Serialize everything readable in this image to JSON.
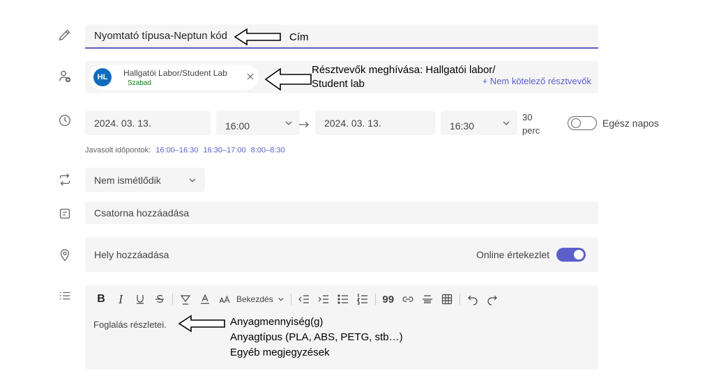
{
  "title": {
    "value": "Nyomtató típusa-Neptun kód"
  },
  "attendees": {
    "chip": {
      "initials": "HL",
      "name": "Hallgatói Labor/Student Lab",
      "status": "Szabad"
    },
    "optional_link": "+ Nem kötelező résztvevők"
  },
  "schedule": {
    "start_date": "2024. 03. 13.",
    "start_time": "16:00",
    "end_date": "2024. 03. 13.",
    "end_time": "16:30",
    "duration_value": "30",
    "duration_unit": "perc",
    "all_day_label": "Egész napos",
    "all_day_on": false
  },
  "suggestions": {
    "label": "Javasolt időpontok:",
    "slots": [
      "16:00–16:30",
      "16:30–17:00",
      "8:00–8:30"
    ]
  },
  "repeat": {
    "value": "Nem ismétlődik"
  },
  "channel": {
    "placeholder": "Csatorna hozzáadása"
  },
  "location": {
    "placeholder": "Hely hozzáadása",
    "online_label": "Online értekezlet",
    "online_on": true
  },
  "editor": {
    "paragraph_style": "Bekezdés",
    "placeholder": "Foglalás részletei."
  },
  "annotations": {
    "title": "Cím",
    "attendees_line1": "Résztvevők meghívása: Hallgatói labor/",
    "attendees_line2": "Student lab",
    "details_line1": "Anyagmennyiség(g)",
    "details_line2": "Anyagtípus (PLA, ABS, PETG, stb…)",
    "details_line3": "Egyéb megjegyzések"
  },
  "colors": {
    "accent": "#5b5fc7",
    "avatar": "#0f6cbd",
    "available": "#107c10",
    "field_bg": "#f5f5f5"
  }
}
